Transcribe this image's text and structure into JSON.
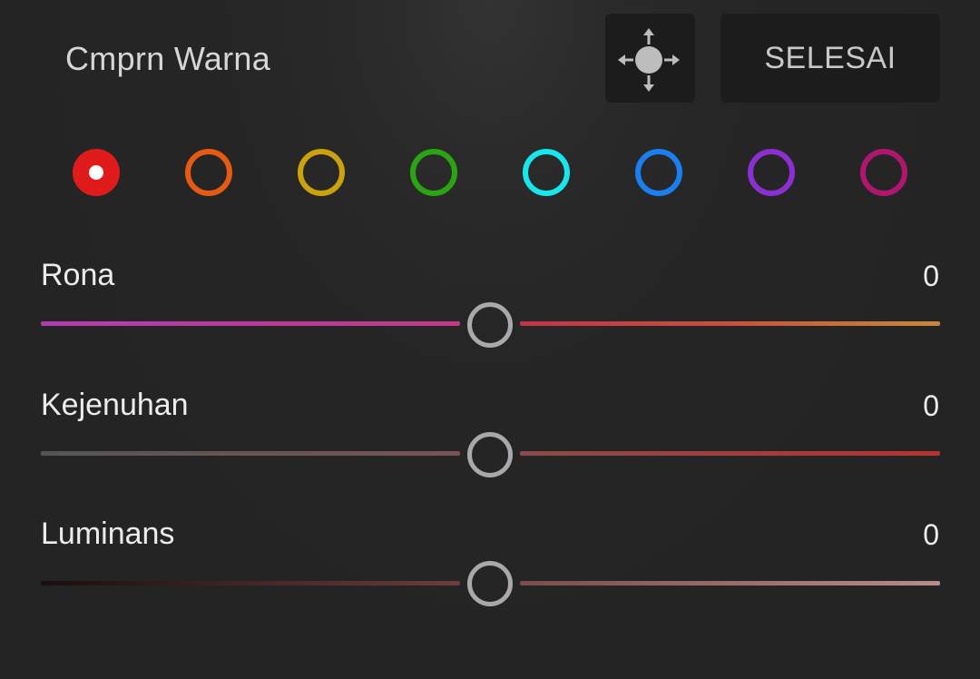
{
  "header": {
    "title": "Cmprn Warna",
    "done_label": "SELESAI",
    "target_icon": "move-target-icon"
  },
  "swatches": [
    {
      "name": "red",
      "color": "#e01b1b",
      "selected": true
    },
    {
      "name": "orange",
      "color": "#e55a15"
    },
    {
      "name": "yellow",
      "color": "#c9a20e"
    },
    {
      "name": "green",
      "color": "#2aa414"
    },
    {
      "name": "aqua",
      "color": "#19e6ec"
    },
    {
      "name": "blue",
      "color": "#1a7ff0"
    },
    {
      "name": "purple",
      "color": "#8a2fd0"
    },
    {
      "name": "magenta",
      "color": "#b0166e"
    }
  ],
  "sliders": {
    "hue": {
      "label": "Rona",
      "value": "0"
    },
    "saturation": {
      "label": "Kejenuhan",
      "value": "0"
    },
    "luminance": {
      "label": "Luminans",
      "value": "0"
    }
  }
}
